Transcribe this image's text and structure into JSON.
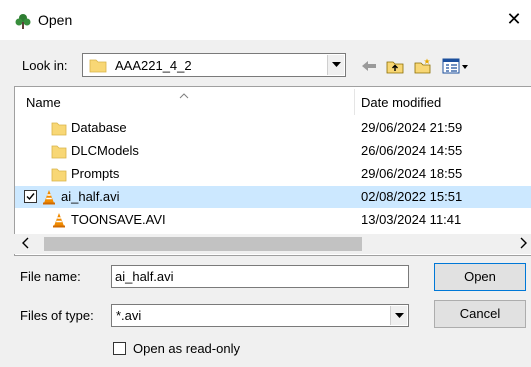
{
  "window": {
    "title": "Open",
    "close_glyph": "✕"
  },
  "look_in": {
    "label": "Look in:",
    "value": "AAA221_4_2"
  },
  "list": {
    "header_name": "Name",
    "header_date": "Date modified",
    "files": [
      {
        "name": "Database",
        "date": "29/06/2024 21:59",
        "icon": "folder-icon",
        "selected": false
      },
      {
        "name": "DLCModels",
        "date": "26/06/2024 14:55",
        "icon": "folder-icon",
        "selected": false
      },
      {
        "name": "Prompts",
        "date": "29/06/2024 18:55",
        "icon": "folder-icon",
        "selected": false
      },
      {
        "name": "ai_half.avi",
        "date": "02/08/2022 15:51",
        "icon": "vlc-cone-icon",
        "selected": true
      },
      {
        "name": "TOONSAVE.AVI",
        "date": "13/03/2024 11:41",
        "icon": "vlc-cone-icon",
        "selected": false
      }
    ]
  },
  "file_name": {
    "label": "File name:",
    "value": "ai_half.avi"
  },
  "file_type": {
    "label": "Files of type:",
    "value": "*.avi"
  },
  "buttons": {
    "open": "Open",
    "cancel": "Cancel"
  },
  "readonly_label": "Open as read-only",
  "colors": {
    "selection": "#cce8ff",
    "folder": "#f8d775",
    "cone": "#f08a00",
    "accent": "#0078d7"
  }
}
